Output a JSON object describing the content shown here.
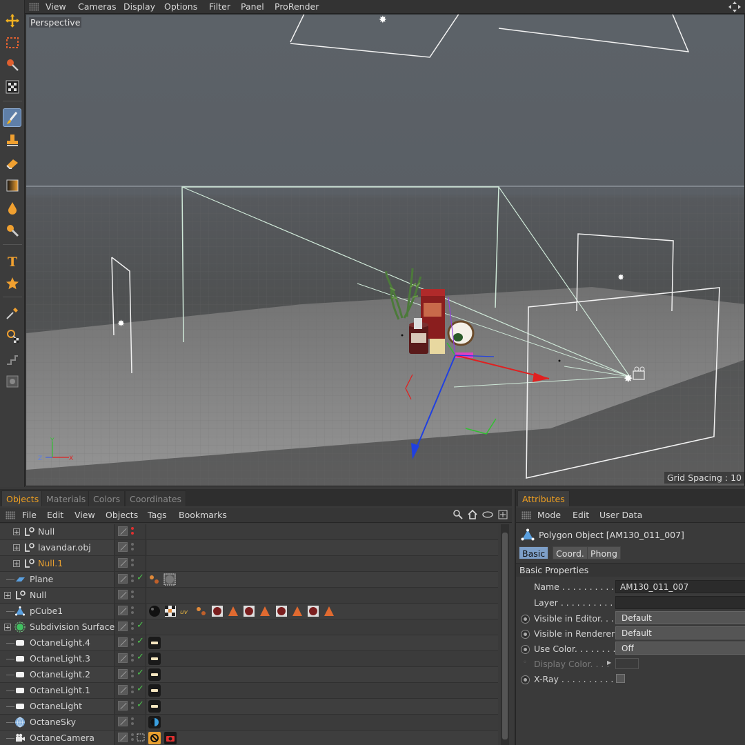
{
  "viewport": {
    "menu": [
      "View",
      "Cameras",
      "Display",
      "Options",
      "Filter",
      "Panel",
      "ProRender"
    ],
    "label": "Perspective",
    "grid_spacing": "Grid Spacing : 10"
  },
  "toolbar": {
    "tools": [
      "move-tool-icon",
      "rectangle-select-icon",
      "live-select-icon",
      "checker-texture-icon",
      "brush-icon",
      "stamp-icon",
      "eraser-icon",
      "gradient-icon",
      "drop-icon",
      "magnifier-tool-icon",
      "text-icon",
      "star-icon",
      "eyedropper-icon",
      "material-pick-icon",
      "step-icon",
      "render-box-icon"
    ],
    "active": "brush-icon"
  },
  "objects_panel": {
    "tabs": [
      "Objects",
      "Materials",
      "Colors",
      "Coordinates"
    ],
    "menu": [
      "File",
      "Edit",
      "View",
      "Objects",
      "Tags",
      "Bookmarks"
    ],
    "rows": [
      {
        "name": "Null",
        "icon": "null-icon"
      },
      {
        "name": "lavandar.obj",
        "icon": "null-icon"
      },
      {
        "name": "Null.1",
        "icon": "null-icon"
      },
      {
        "name": "Plane",
        "icon": "plane-icon"
      },
      {
        "name": "Null",
        "icon": "null-icon"
      },
      {
        "name": "pCube1",
        "icon": "polygon-icon"
      },
      {
        "name": "Subdivision Surface",
        "icon": "subdivision-icon"
      },
      {
        "name": "OctaneLight.4",
        "icon": "light-icon"
      },
      {
        "name": "OctaneLight.3",
        "icon": "light-icon"
      },
      {
        "name": "OctaneLight.2",
        "icon": "light-icon"
      },
      {
        "name": "OctaneLight.1",
        "icon": "light-icon"
      },
      {
        "name": "OctaneLight",
        "icon": "light-icon"
      },
      {
        "name": "OctaneSky",
        "icon": "sky-icon"
      },
      {
        "name": "OctaneCamera",
        "icon": "camera-icon"
      }
    ]
  },
  "attributes_panel": {
    "tab": "Attributes",
    "menu": [
      "Mode",
      "Edit",
      "User Data"
    ],
    "object_title": "Polygon Object [AM130_011_007]",
    "subtabs": [
      "Basic",
      "Coord.",
      "Phong"
    ],
    "section": "Basic Properties",
    "fields": {
      "name_label": "Name . . . . . . . . . . .",
      "name_value": "AM130_011_007",
      "layer_label": "Layer . . . . . . . . . . .",
      "visible_editor_label": "Visible in Editor. . .",
      "visible_editor_value": "Default",
      "visible_renderer_label": "Visible in Renderer",
      "visible_renderer_value": "Default",
      "use_color_label": "Use Color. . . . . . . .",
      "use_color_value": "Off",
      "display_color_label": "Display Color. . . .",
      "xray_label": "X-Ray . . . . . . . . . ."
    }
  },
  "colors": {
    "accent": "#f0a020",
    "selected_tab": "#7d9fc8",
    "check": "#4cc24c"
  }
}
